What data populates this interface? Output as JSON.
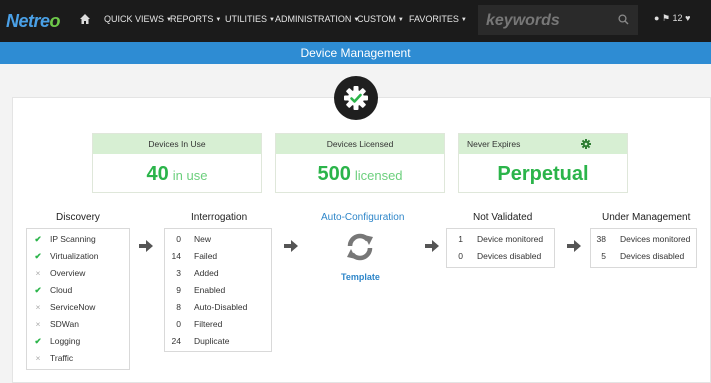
{
  "nav": {
    "logo_main": "Netre",
    "logo_tail": "o",
    "items": [
      "QUICK VIEWS",
      "REPORTS",
      "UTILITIES",
      "ADMINISTRATION",
      "CUSTOM",
      "FAVORITES"
    ],
    "search_placeholder": "keywords",
    "alerts_count": "12"
  },
  "page": {
    "title": "Device Management"
  },
  "cards": {
    "in_use": {
      "header": "Devices In Use",
      "value": "40",
      "suffix": "in use"
    },
    "licensed": {
      "header": "Devices Licensed",
      "value": "500",
      "suffix": "licensed"
    },
    "expires": {
      "header": "Never Expires",
      "value": "Perpetual"
    }
  },
  "sections": {
    "discovery": {
      "title": "Discovery",
      "items": [
        {
          "label": "IP Scanning",
          "status": "enabled"
        },
        {
          "label": "Virtualization",
          "status": "enabled"
        },
        {
          "label": "Overview",
          "status": "disabled"
        },
        {
          "label": "Cloud",
          "status": "enabled"
        },
        {
          "label": "ServiceNow",
          "status": "disabled"
        },
        {
          "label": "SDWan",
          "status": "disabled"
        },
        {
          "label": "Logging",
          "status": "enabled"
        },
        {
          "label": "Traffic",
          "status": "disabled"
        }
      ]
    },
    "interrogation": {
      "title": "Interrogation",
      "items": [
        {
          "count": "0",
          "label": "New"
        },
        {
          "count": "14",
          "label": "Failed"
        },
        {
          "count": "3",
          "label": "Added"
        },
        {
          "count": "9",
          "label": "Enabled"
        },
        {
          "count": "8",
          "label": "Auto-Disabled"
        },
        {
          "count": "0",
          "label": "Filtered"
        },
        {
          "count": "24",
          "label": "Duplicate"
        }
      ]
    },
    "autoconfig": {
      "title": "Auto-Configuration",
      "link": "Template"
    },
    "not_validated": {
      "title": "Not Validated",
      "items": [
        {
          "count": "1",
          "label": "Device monitored"
        },
        {
          "count": "0",
          "label": "Devices disabled"
        }
      ]
    },
    "under_management": {
      "title": "Under Management",
      "items": [
        {
          "count": "38",
          "label": "Devices monitored"
        },
        {
          "count": "5",
          "label": "Devices disabled"
        }
      ]
    }
  },
  "colors": {
    "accent": "#2e8cd3",
    "ok": "#2bb44a",
    "nav_bg": "#1b1b1b"
  }
}
